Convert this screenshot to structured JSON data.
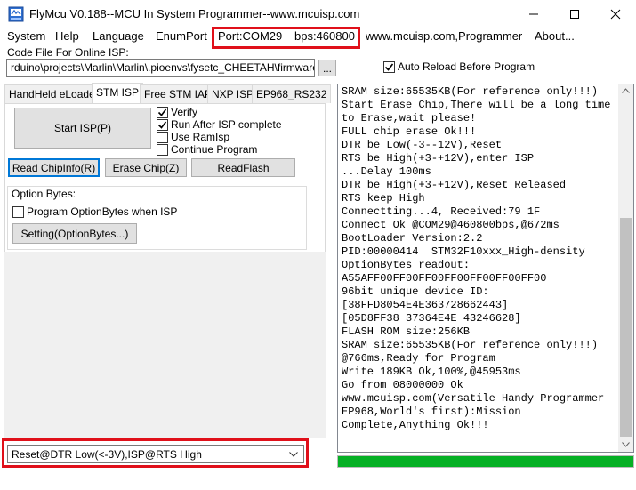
{
  "window": {
    "title": "FlyMcu V0.188--MCU In System Programmer--www.mcuisp.com"
  },
  "menu": {
    "system": "System",
    "help": "Help",
    "language": "Language",
    "enumport": "EnumPort",
    "port": "Port:COM29",
    "bps": "bps:460800",
    "website": "www.mcuisp.com,Programmer",
    "about": "About..."
  },
  "code_file": {
    "label": "Code File For Online ISP:",
    "value": "rduino\\projects\\Marlin\\Marlin\\.pioenvs\\fysetc_CHEETAH\\firmware.hex",
    "browse_label": "...",
    "auto_reload_label": "Auto Reload Before Program",
    "auto_reload_checked": true
  },
  "tabs": [
    "HandHeld eLoader",
    "STM ISP",
    "Free STM IAP",
    "NXP ISP",
    "EP968_RS232"
  ],
  "stm_isp": {
    "start_isp_label": "Start ISP(P)",
    "verify_label": "Verify",
    "verify_checked": true,
    "run_after_label": "Run After ISP complete",
    "run_after_checked": true,
    "use_ramisp_label": "Use RamIsp",
    "use_ramisp_checked": false,
    "continue_label": "Continue Program",
    "continue_checked": false,
    "read_chipinfo_label": "Read ChipInfo(R)",
    "erase_chip_label": "Erase Chip(Z)",
    "readflash_label": "ReadFlash",
    "option_bytes_title": "Option Bytes:",
    "program_optionbytes_label": "Program OptionBytes when ISP",
    "program_optionbytes_checked": false,
    "setting_label": "Setting(OptionBytes...)"
  },
  "log_text": "SRAM size:65535KB(For reference only!!!)\nStart Erase Chip,There will be a long time\nto Erase,wait please!\nFULL chip erase Ok!!!\nDTR be Low(-3--12V),Reset\nRTS be High(+3-+12V),enter ISP\n...Delay 100ms\nDTR be High(+3-+12V),Reset Released\nRTS keep High\nConnectting...4, Received:79 1F\nConnect Ok @COM29@460800bps,@672ms\nBootLoader Version:2.2\nPID:00000414  STM32F10xxx_High-density\nOptionBytes readout:\nA55AFF00FF00FF00FF00FF00FF00FF00\n96bit unique device ID:\n[38FFD8054E4E363728662443]\n[05D8FF38 37364E4E 43246628]\nFLASH ROM size:256KB\nSRAM size:65535KB(For reference only!!!)\n@766ms,Ready for Program\nWrite 189KB Ok,100%,@45953ms\nGo from 08000000 Ok\nwww.mcuisp.com(Versatile Handy Programmer\nEP968,World's first):Mission\nComplete,Anything Ok!!!",
  "progress": {
    "value": 1.0
  },
  "reset_mode": {
    "selected": "Reset@DTR Low(<-3V),ISP@RTS High"
  },
  "colors": {
    "highlight_box": "#e0101a",
    "progress": "#06b025",
    "focus": "#0078d7"
  }
}
